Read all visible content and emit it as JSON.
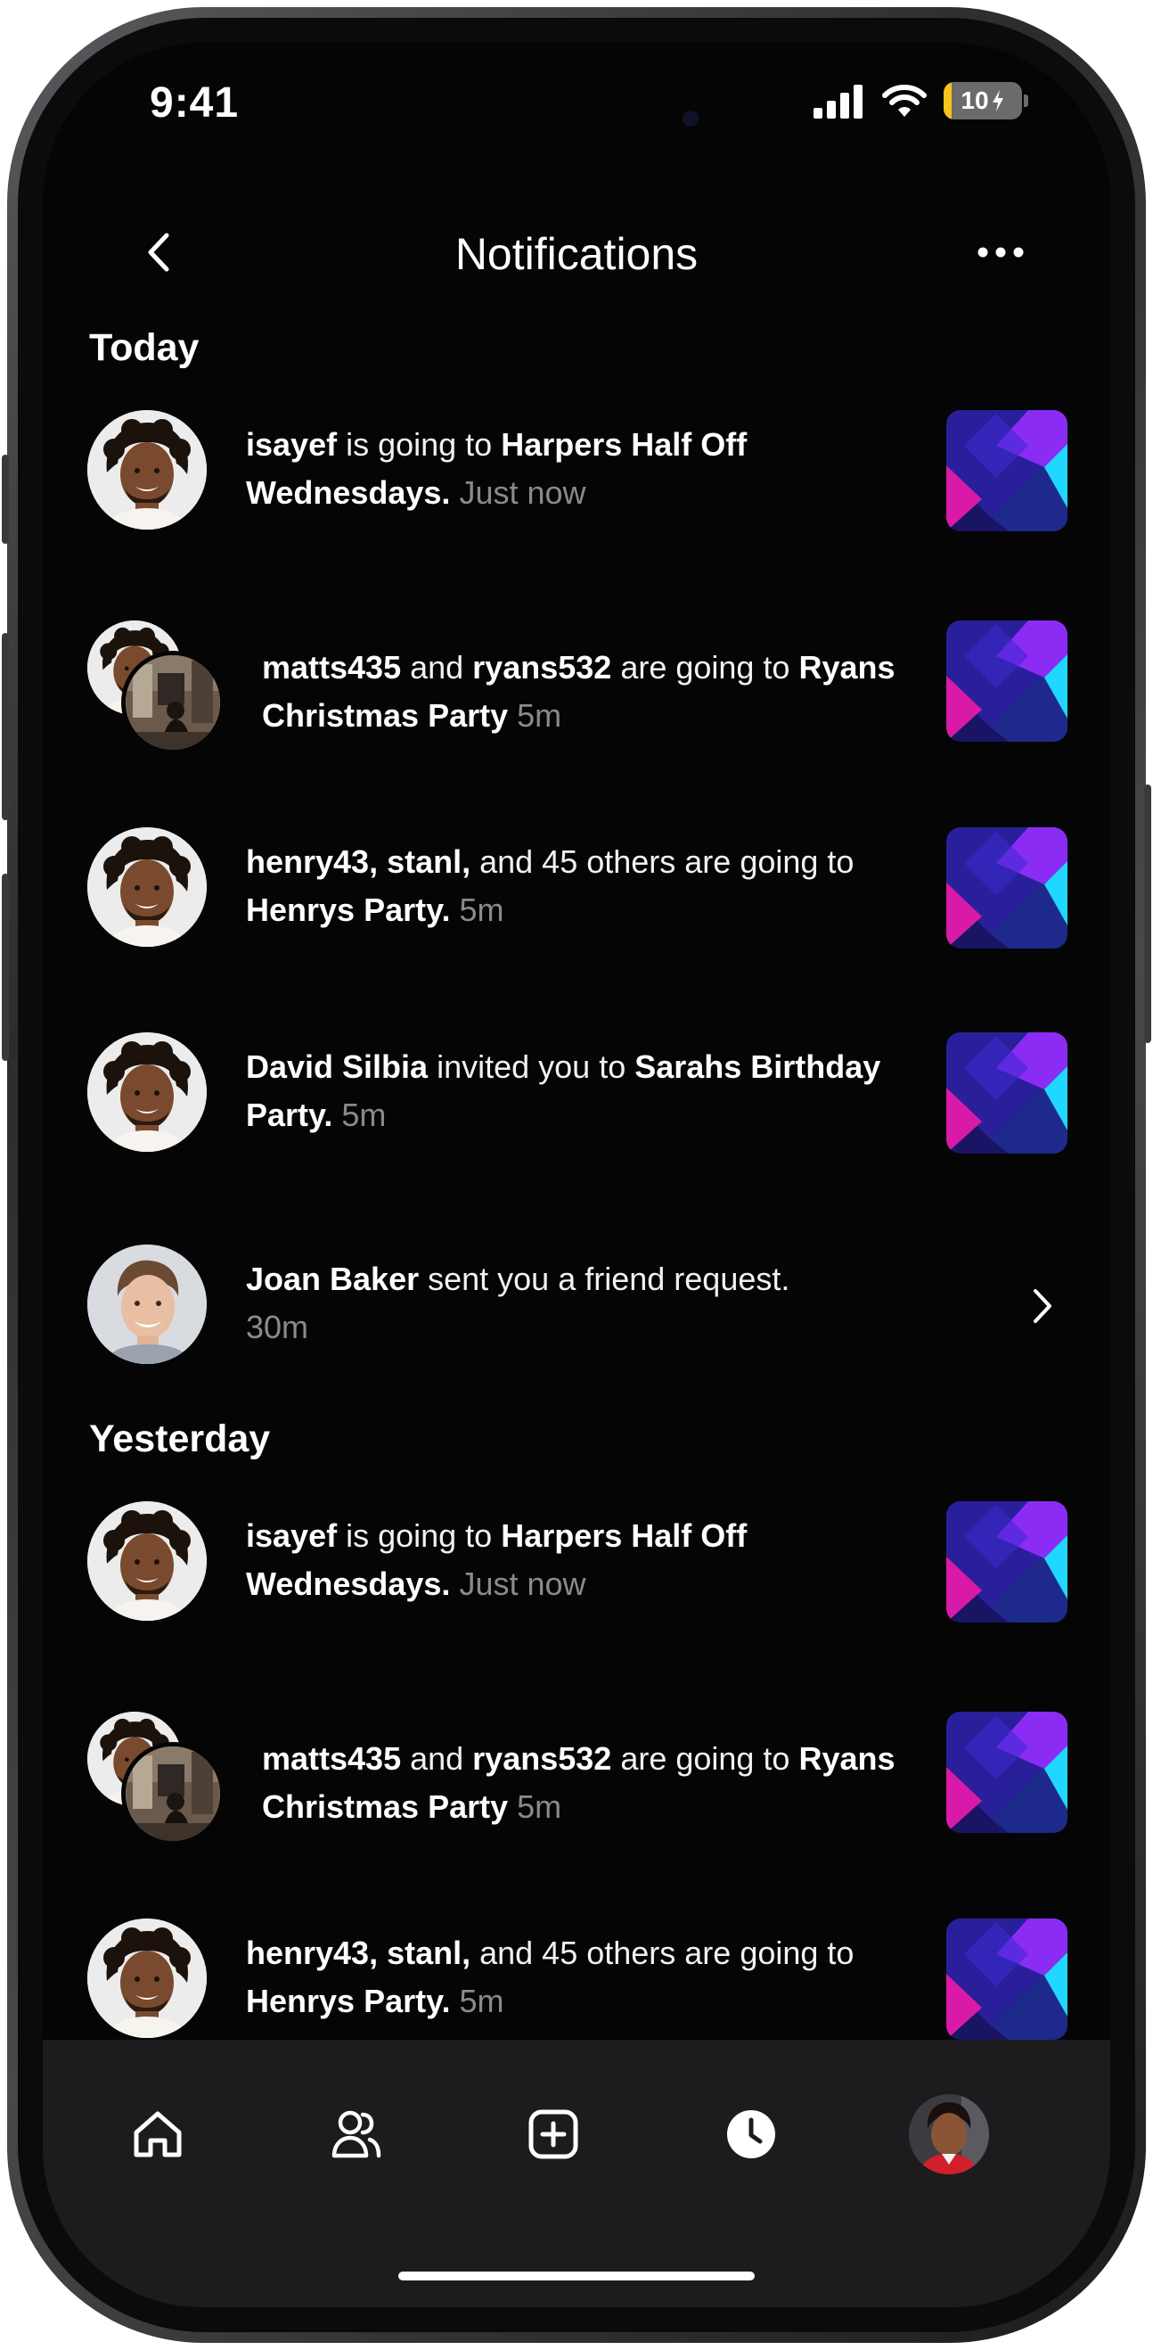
{
  "status_bar": {
    "time": "9:41",
    "battery_level": "10",
    "battery_fraction": 0.1
  },
  "header": {
    "title": "Notifications",
    "back_icon": "chevron-left-icon",
    "more_icon": "ellipsis-icon"
  },
  "sections": {
    "today": "Today",
    "yesterday": "Yesterday"
  },
  "notifications": {
    "n1": {
      "user": "isayef",
      "mid": " is going to ",
      "event": "Harpers Half Off Wednesdays.",
      "time": "Just now"
    },
    "n2": {
      "user1": "matts435",
      "and": " and ",
      "user2": "ryans532",
      "mid": " are going to ",
      "event": "Ryans Christmas Party",
      "time": "5m"
    },
    "n3": {
      "users": "henry43, stanl,",
      "mid": " and 45 others are going to ",
      "event": "Henrys Party.",
      "time": "5m"
    },
    "n4": {
      "user": "David Silbia",
      "mid": " invited you to ",
      "event": "Sarahs Birthday Party.",
      "time": "5m"
    },
    "n5": {
      "user": "Joan Baker",
      "mid": " sent you a friend request.",
      "time": "30m"
    },
    "n6": {
      "user": "isayef",
      "mid": " is going to ",
      "event": "Harpers Half Off Wednesdays.",
      "time": "Just now"
    },
    "n7": {
      "user1": "matts435",
      "and": " and ",
      "user2": "ryans532",
      "mid": " are going to ",
      "event": "Ryans Christmas Party",
      "time": "5m"
    },
    "n8": {
      "users": "henry43, stanl,",
      "mid": " and 45 others are going to ",
      "event": "Henrys Party.",
      "time": "5m"
    }
  },
  "tabbar": {
    "tabs": [
      "home-icon",
      "friends-icon",
      "add-icon",
      "activity-icon",
      "profile-avatar"
    ],
    "active": "activity-icon"
  },
  "colors": {
    "background": "#050505",
    "tabbar": "#1c1c1e",
    "muted_text": "#8a8a8e",
    "thumb_purple": "#8b2cf5",
    "thumb_cyan": "#1fd7ff",
    "thumb_magenta": "#d91aa8",
    "battery_yellow": "#f5c518"
  }
}
